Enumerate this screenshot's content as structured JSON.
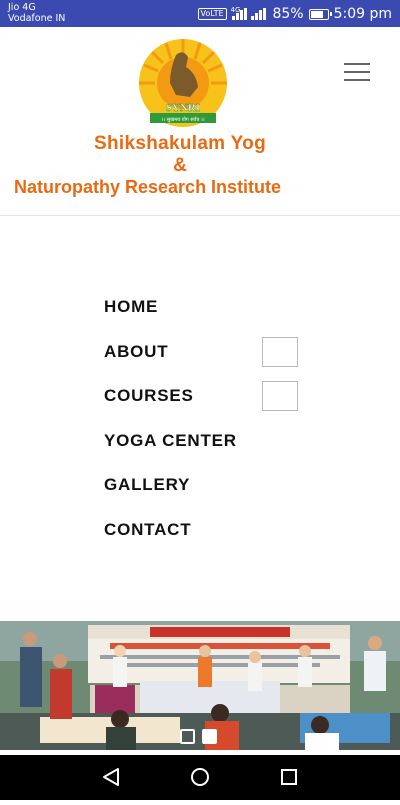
{
  "status_bar": {
    "carrier_1": "Jio 4G",
    "carrier_2": "Vodafone IN",
    "volte": "VoLTE",
    "network": "4G",
    "battery": "85%",
    "battery_level": 0.85,
    "time": "5:09 pm"
  },
  "header": {
    "logo_text": "SYNRI",
    "logo_tagline": "।। सुखमय योग सर्वत्र ।।",
    "brand_line_1": "Shikshakulam Yog",
    "brand_line_2": "&",
    "brand_line_3": "Naturopathy Research Institute",
    "menu_icon": "hamburger-menu-icon"
  },
  "nav": {
    "items": [
      {
        "label": "HOME"
      },
      {
        "label": "ABOUT"
      },
      {
        "label": "COURSES"
      },
      {
        "label": "YOGA CENTER"
      },
      {
        "label": "GALLERY"
      },
      {
        "label": "CONTACT"
      }
    ]
  },
  "banner": {
    "slide_count": 2,
    "active_slide": 2
  },
  "android_nav": {
    "back": "back-icon",
    "home": "home-icon",
    "recents": "recents-icon"
  },
  "colors": {
    "status_bar": "#3b4ab0",
    "brand_orange": "#e86a12",
    "logo_green": "#2e9a3a"
  }
}
